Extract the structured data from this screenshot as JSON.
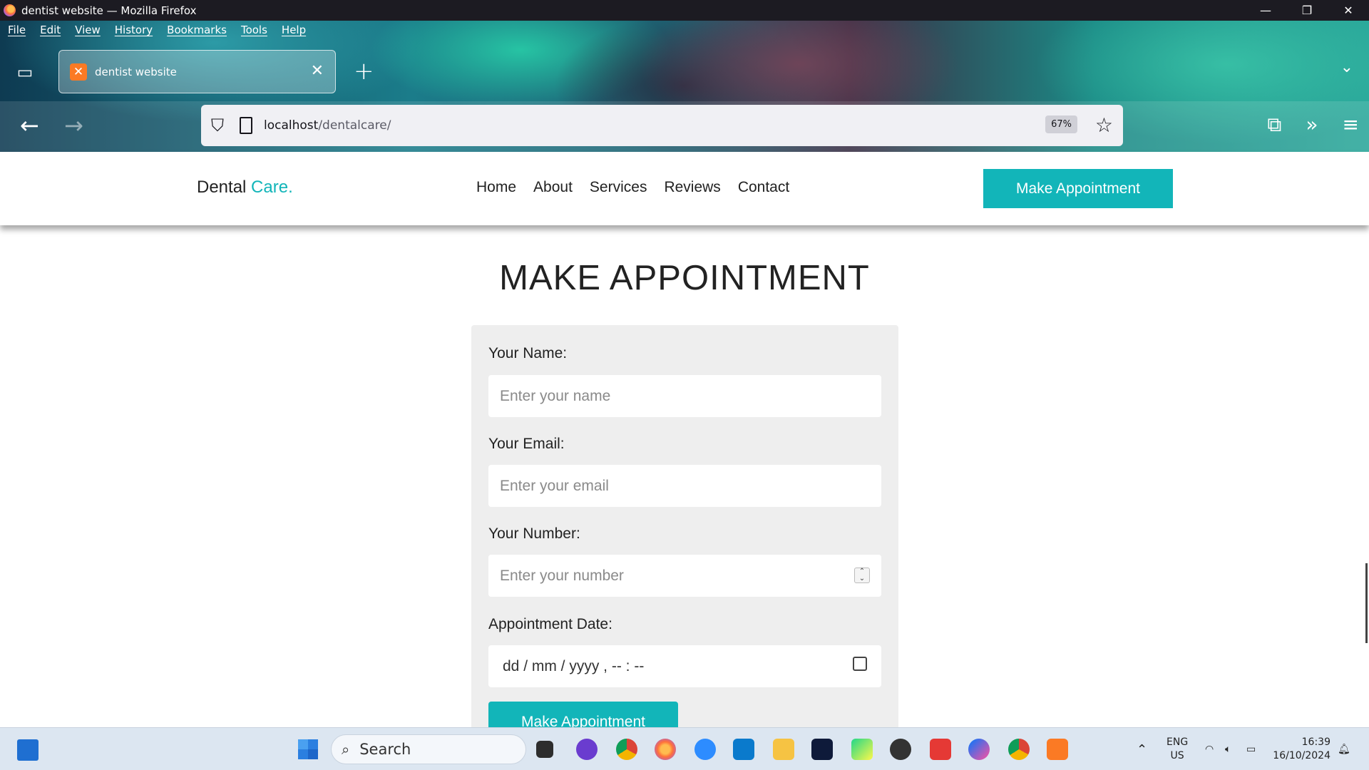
{
  "window": {
    "title": "dentist website — Mozilla Firefox",
    "controls": {
      "minimize": "—",
      "restore": "❐",
      "close": "✕"
    }
  },
  "menu": [
    "File",
    "Edit",
    "View",
    "History",
    "Bookmarks",
    "Tools",
    "Help"
  ],
  "tab": {
    "title": "dentist website",
    "close": "✕"
  },
  "new_tab": "+",
  "address_bar": {
    "host": "localhost",
    "path": "/dentalcare/",
    "zoom": "67%"
  },
  "site": {
    "logo": {
      "main": "Dental ",
      "accent": "Care."
    },
    "nav": [
      "Home",
      "About",
      "Services",
      "Reviews",
      "Contact"
    ],
    "cta": "Make Appointment",
    "accent_color": "#12b5b9"
  },
  "form": {
    "heading": "MAKE APPOINTMENT",
    "name_label": "Your Name:",
    "name_placeholder": "Enter your name",
    "email_label": "Your Email:",
    "email_placeholder": "Enter your email",
    "number_label": "Your Number:",
    "number_placeholder": "Enter your number",
    "date_label": "Appointment Date:",
    "date_placeholder": "dd / mm / yyyy ,  -- : --",
    "submit": "Make Appointment"
  },
  "taskbar": {
    "search": "Search",
    "lang_top": "ENG",
    "lang_bottom": "US",
    "time": "16:39",
    "date": "16/10/2024"
  }
}
